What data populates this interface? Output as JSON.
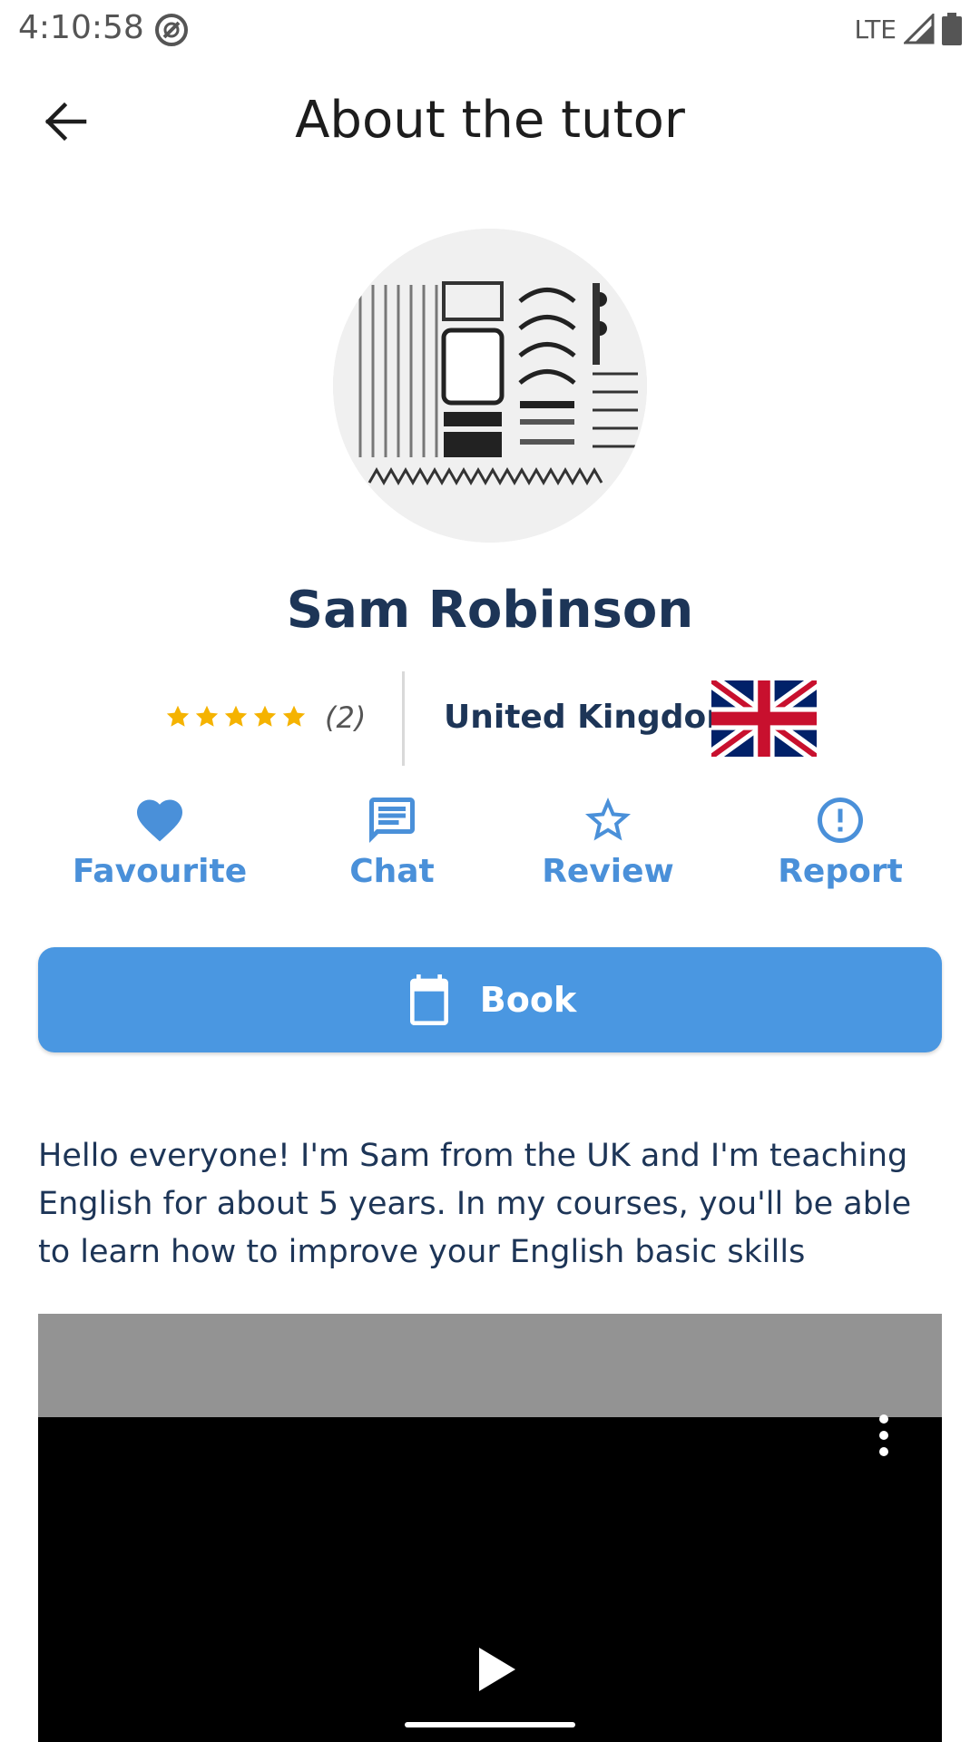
{
  "status_bar": {
    "time": "4:10:58",
    "network": "LTE"
  },
  "header": {
    "title": "About the tutor"
  },
  "tutor": {
    "name": "Sam Robinson",
    "rating_stars": 5,
    "review_count": "(2)",
    "country": "United Kingdom",
    "bio": "Hello everyone! I'm Sam from the UK and I'm teaching English for about 5 years. In my courses, you'll be able to learn how to improve your English basic skills"
  },
  "actions": {
    "favourite_label": "Favourite",
    "chat_label": "Chat",
    "review_label": "Review",
    "report_label": "Report"
  },
  "book_button": {
    "label": "Book"
  },
  "colors": {
    "accent": "#4a90d9",
    "book_button": "#4a97e1",
    "star": "#f5b301",
    "name_text": "#1d3557"
  },
  "icons": {
    "back": "arrow-left-icon",
    "favourite": "heart-icon",
    "chat": "chat-bubble-icon",
    "review": "star-outline-icon",
    "report": "alert-circle-icon",
    "book": "calendar-icon",
    "video_menu": "more-vertical-icon",
    "play": "play-icon"
  }
}
